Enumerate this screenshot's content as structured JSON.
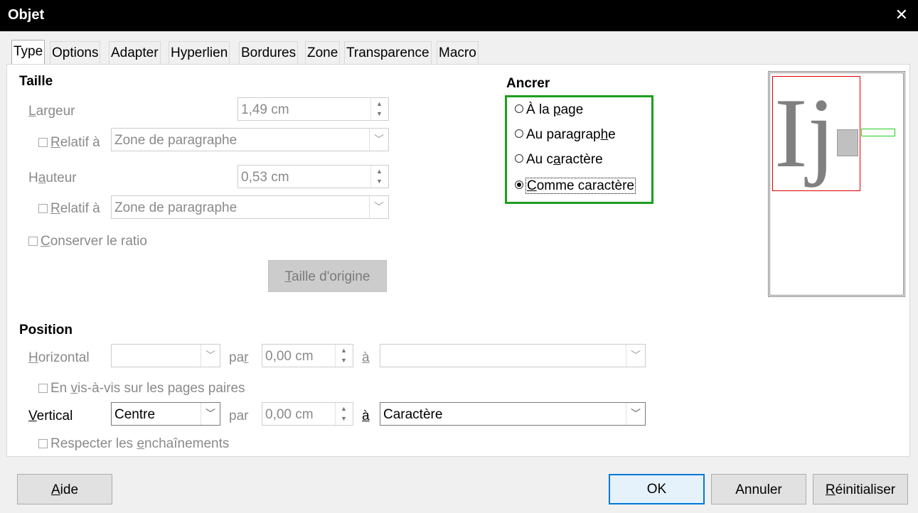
{
  "window": {
    "title": "Objet"
  },
  "tabs": [
    {
      "label": "Type",
      "selected": true
    },
    {
      "label": "Options"
    },
    {
      "label": "Adapter"
    },
    {
      "label": "Hyperlien"
    },
    {
      "label": "Bordures"
    },
    {
      "label": "Zone"
    },
    {
      "label": "Transparence"
    },
    {
      "label": "Macro"
    }
  ],
  "size": {
    "heading": "Taille",
    "width_label": "Largeur",
    "width_value": "1,49 cm",
    "relative_label": "Relatif à",
    "width_relative_value": "Zone de paragraphe",
    "height_label": "Hauteur",
    "height_value": "0,53 cm",
    "height_relative_value": "Zone de paragraphe",
    "keep_ratio_label": "Conserver le ratio",
    "original_size_button": "Taille d'origine"
  },
  "anchor": {
    "heading": "Ancrer",
    "options": [
      {
        "label": "À la page",
        "checked": false
      },
      {
        "label": "Au paragraphe",
        "checked": false
      },
      {
        "label": "Au caractère",
        "checked": false
      },
      {
        "label": "Comme caractère",
        "checked": true
      }
    ]
  },
  "preview": {
    "glyphs": "Ij"
  },
  "position": {
    "heading": "Position",
    "horizontal_label": "Horizontal",
    "horizontal_value": "",
    "by_label": "par",
    "horizontal_by_value": "0,00 cm",
    "to_label": "à",
    "horizontal_to_value": "",
    "mirror_label": "En vis-à-vis sur les pages paires",
    "vertical_label": "Vertical",
    "vertical_value": "Centre",
    "vertical_by_value": "0,00 cm",
    "vertical_to_value": "Caractère",
    "follow_flow_label": "Respecter les enchaînements"
  },
  "buttons": {
    "help": "Aide",
    "ok": "OK",
    "cancel": "Annuler",
    "reset": "Réinitialiser"
  },
  "colors": {
    "anchor_highlight": "#1e9e1e",
    "default_button": "#0078d7",
    "preview_frame": "#e00000"
  }
}
